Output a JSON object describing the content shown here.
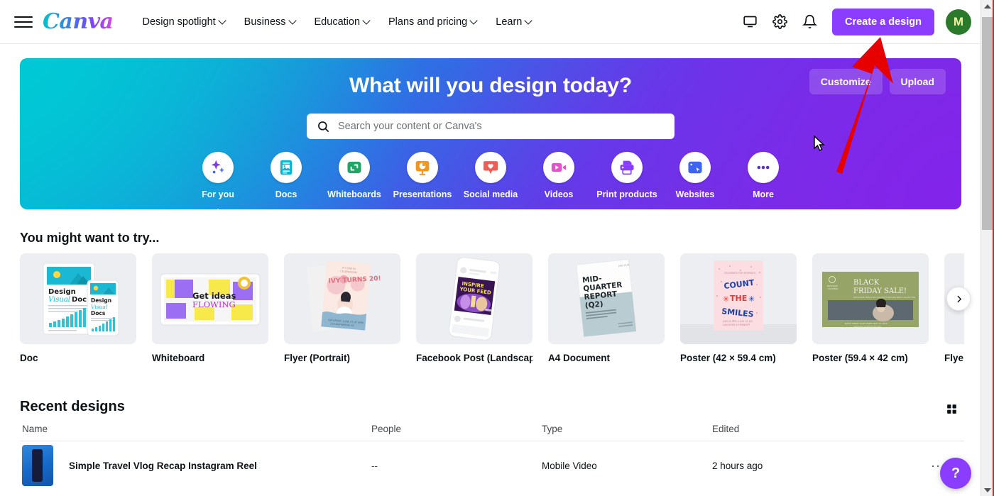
{
  "header": {
    "menu_icon": "hamburger-icon",
    "logo_text": "Canva",
    "nav": [
      {
        "label": "Design spotlight",
        "has_caret": true
      },
      {
        "label": "Business",
        "has_caret": true
      },
      {
        "label": "Education",
        "has_caret": true
      },
      {
        "label": "Plans and pricing",
        "has_caret": true
      },
      {
        "label": "Learn",
        "has_caret": true
      }
    ],
    "icons": [
      {
        "name": "display-icon"
      },
      {
        "name": "gear-icon"
      },
      {
        "name": "bell-icon"
      }
    ],
    "create_button": "Create a design",
    "avatar_initial": "M",
    "avatar_color": "#2b7a2b",
    "accent_color": "#8b3dff"
  },
  "hero": {
    "title": "What will you design today?",
    "customize_label": "Customize",
    "upload_label": "Upload",
    "search": {
      "placeholder": "Search your content or Canva's",
      "value": "",
      "icon": "search-icon"
    },
    "gradient_from": "#00c4cc",
    "gradient_to": "#7b2fe0",
    "categories": [
      {
        "label": "For you",
        "icon": "sparkles-icon",
        "color": "#7b3fe4",
        "active": true
      },
      {
        "label": "Docs",
        "icon": "document-icon",
        "color": "#00b8d4",
        "active": false
      },
      {
        "label": "Whiteboards",
        "icon": "whiteboard-icon",
        "color": "#20a765",
        "active": false
      },
      {
        "label": "Presentations",
        "icon": "presentation-icon",
        "color": "#f5941f",
        "active": false
      },
      {
        "label": "Social media",
        "icon": "heart-chat-icon",
        "color": "#f25c54",
        "active": false
      },
      {
        "label": "Videos",
        "icon": "video-camera-icon",
        "color": "#e055c9",
        "active": false
      },
      {
        "label": "Print products",
        "icon": "printer-icon",
        "color": "#8b3dff",
        "active": false
      },
      {
        "label": "Websites",
        "icon": "website-cursor-icon",
        "color": "#3d64f4",
        "active": false
      },
      {
        "label": "More",
        "icon": "ellipsis-icon",
        "color": "#5b2fd6",
        "active": false
      }
    ]
  },
  "try_section": {
    "title": "You might want to try...",
    "next_button_icon": "chevron-right-icon",
    "cards": [
      {
        "label": "Doc",
        "art": "doc"
      },
      {
        "label": "Whiteboard",
        "art": "whiteboard"
      },
      {
        "label": "Flyer (Portrait)",
        "art": "flyer"
      },
      {
        "label": "Facebook Post (Landscape)",
        "art": "facebook"
      },
      {
        "label": "A4 Document",
        "art": "a4doc"
      },
      {
        "label": "Poster (42 × 59.4 cm)",
        "art": "poster_portrait"
      },
      {
        "label": "Poster (59.4 × 42 cm)",
        "art": "poster_landscape"
      },
      {
        "label": "Flye",
        "art": "flyer2"
      }
    ],
    "art_text": {
      "doc_title_line1": "Design",
      "doc_title_line2": "Visual",
      "doc_title_line3": "Docs",
      "whiteboard_line1": "Get ideas",
      "whiteboard_line2": "FLOWING",
      "flyer_line": "IVY TURNS 20!",
      "facebook_line1": "INSPIRE",
      "facebook_line2": "YOUR FEED",
      "a4_line1": "MID-",
      "a4_line2": "QUARTER",
      "a4_line3": "REPORT",
      "a4_line4": "(Q2)",
      "poster_p_line1": "COUNT",
      "poster_p_line2": "THE",
      "poster_p_line3": "SMILES",
      "poster_l_line1": "BLACK",
      "poster_l_line2": "FRIDAY SALE!"
    }
  },
  "recent": {
    "title": "Recent designs",
    "grid_toggle_icon": "grid-view-icon",
    "columns": [
      "Name",
      "People",
      "Type",
      "Edited"
    ],
    "rows": [
      {
        "name": "Simple Travel Vlog Recap Instagram Reel",
        "people": "--",
        "type": "Mobile Video",
        "edited": "2 hours ago",
        "menu_icon": "more-options-icon"
      }
    ]
  },
  "help_fab": {
    "label": "?",
    "color": "#8b3dff"
  },
  "annotation": {
    "arrow_color": "#e60000",
    "shape": "up-arrow"
  },
  "scrollbar": {
    "position": "right",
    "thumb_top_pct": 4,
    "thumb_height_pct": 43
  }
}
